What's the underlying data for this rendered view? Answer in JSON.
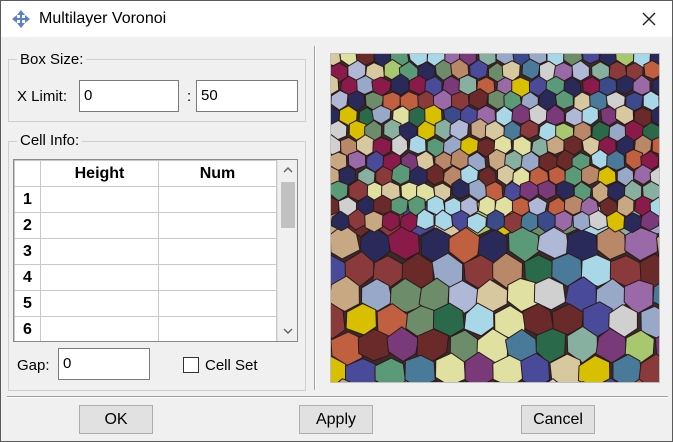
{
  "window": {
    "title": "Multilayer Voronoi"
  },
  "box_size": {
    "label": "Box Size:",
    "x_limit_label": "X Limit:",
    "x_min": "0",
    "separator": ":",
    "x_max": "50"
  },
  "cell_info": {
    "label": "Cell Info:",
    "columns": [
      "Height",
      "Num"
    ],
    "rows": [
      {
        "num": "1",
        "height": "",
        "count": ""
      },
      {
        "num": "2",
        "height": "",
        "count": ""
      },
      {
        "num": "3",
        "height": "",
        "count": ""
      },
      {
        "num": "4",
        "height": "",
        "count": ""
      },
      {
        "num": "5",
        "height": "",
        "count": ""
      },
      {
        "num": "6",
        "height": "",
        "count": ""
      }
    ]
  },
  "gap": {
    "label": "Gap:",
    "value": "0"
  },
  "cell_set": {
    "label": "Cell Set",
    "checked": false
  },
  "buttons": {
    "ok": "OK",
    "apply": "Apply",
    "cancel": "Cancel"
  },
  "icons": {
    "app": "diamond-arrows-icon",
    "close": "close-icon",
    "scroll_up": "chevron-up-icon",
    "scroll_down": "chevron-down-icon"
  },
  "preview": {
    "palette": [
      "#6c8c6a",
      "#c8a882",
      "#3a4a8a",
      "#b0b8d8",
      "#8a3a3a",
      "#d8c000",
      "#8a1a4a",
      "#4a7a9a",
      "#d8c8a0",
      "#2a6a4a",
      "#a8c870",
      "#7a3a7a",
      "#d0d0d0",
      "#b88868",
      "#4a4a9a",
      "#98a8c8",
      "#5a9a78",
      "#c06040",
      "#2a2a5a",
      "#e0e0a0",
      "#6a2a2a",
      "#a8d8e8",
      "#9a6aa8",
      "#88b0a0"
    ]
  }
}
